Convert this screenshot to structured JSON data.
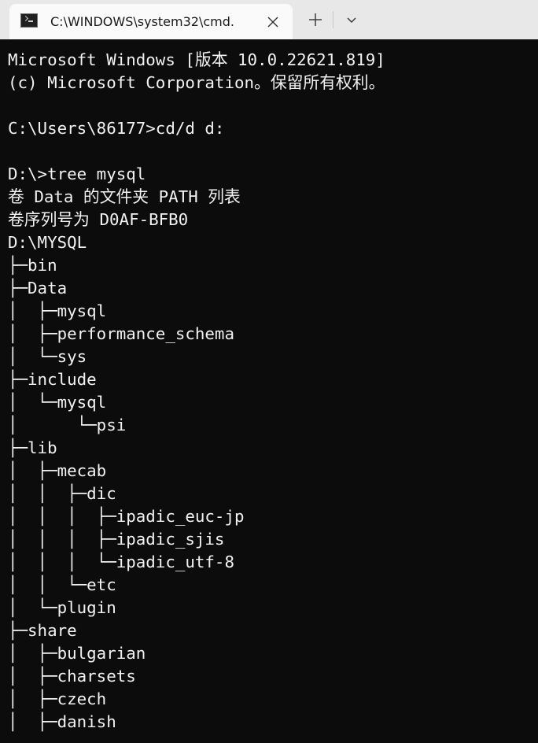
{
  "tab": {
    "title": "C:\\WINDOWS\\system32\\cmd.",
    "icon": "cmd-terminal-icon",
    "close_icon": "close-icon"
  },
  "toolbar": {
    "new_tab_icon": "plus-icon",
    "dropdown_icon": "chevron-down-icon"
  },
  "colors": {
    "terminal_bg": "#0c0c0c",
    "terminal_fg": "#f2f2f2",
    "titlebar_bg": "#e8e8e8",
    "tab_bg": "#fafafa"
  },
  "terminal": {
    "lines": [
      "Microsoft Windows [版本 10.0.22621.819]",
      "(c) Microsoft Corporation。保留所有权利。",
      "",
      "C:\\Users\\86177>cd/d d:",
      "",
      "D:\\>tree mysql",
      "卷 Data 的文件夹 PATH 列表",
      "卷序列号为 D0AF-BFB0",
      "D:\\MYSQL",
      "├─bin",
      "├─Data",
      "│  ├─mysql",
      "│  ├─performance_schema",
      "│  └─sys",
      "├─include",
      "│  └─mysql",
      "│      └─psi",
      "├─lib",
      "│  ├─mecab",
      "│  │  ├─dic",
      "│  │  │  ├─ipadic_euc-jp",
      "│  │  │  ├─ipadic_sjis",
      "│  │  │  └─ipadic_utf-8",
      "│  │  └─etc",
      "│  └─plugin",
      "├─share",
      "│  ├─bulgarian",
      "│  ├─charsets",
      "│  ├─czech",
      "│  ├─danish"
    ]
  }
}
